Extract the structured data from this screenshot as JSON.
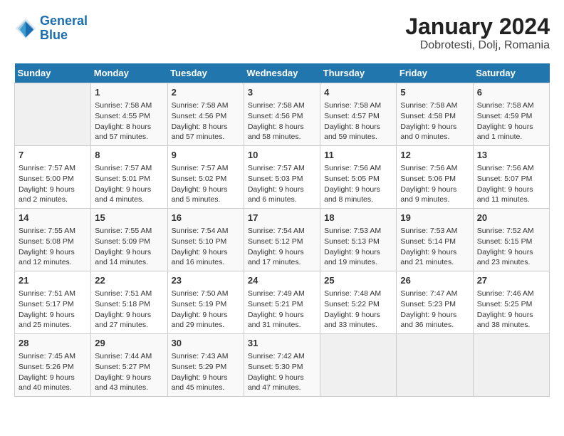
{
  "logo": {
    "line1": "General",
    "line2": "Blue"
  },
  "title": "January 2024",
  "subtitle": "Dobrotesti, Dolj, Romania",
  "weekdays": [
    "Sunday",
    "Monday",
    "Tuesday",
    "Wednesday",
    "Thursday",
    "Friday",
    "Saturday"
  ],
  "weeks": [
    [
      {
        "day": "",
        "info": ""
      },
      {
        "day": "1",
        "info": "Sunrise: 7:58 AM\nSunset: 4:55 PM\nDaylight: 8 hours\nand 57 minutes."
      },
      {
        "day": "2",
        "info": "Sunrise: 7:58 AM\nSunset: 4:56 PM\nDaylight: 8 hours\nand 57 minutes."
      },
      {
        "day": "3",
        "info": "Sunrise: 7:58 AM\nSunset: 4:56 PM\nDaylight: 8 hours\nand 58 minutes."
      },
      {
        "day": "4",
        "info": "Sunrise: 7:58 AM\nSunset: 4:57 PM\nDaylight: 8 hours\nand 59 minutes."
      },
      {
        "day": "5",
        "info": "Sunrise: 7:58 AM\nSunset: 4:58 PM\nDaylight: 9 hours\nand 0 minutes."
      },
      {
        "day": "6",
        "info": "Sunrise: 7:58 AM\nSunset: 4:59 PM\nDaylight: 9 hours\nand 1 minute."
      }
    ],
    [
      {
        "day": "7",
        "info": "Sunrise: 7:57 AM\nSunset: 5:00 PM\nDaylight: 9 hours\nand 2 minutes."
      },
      {
        "day": "8",
        "info": "Sunrise: 7:57 AM\nSunset: 5:01 PM\nDaylight: 9 hours\nand 4 minutes."
      },
      {
        "day": "9",
        "info": "Sunrise: 7:57 AM\nSunset: 5:02 PM\nDaylight: 9 hours\nand 5 minutes."
      },
      {
        "day": "10",
        "info": "Sunrise: 7:57 AM\nSunset: 5:03 PM\nDaylight: 9 hours\nand 6 minutes."
      },
      {
        "day": "11",
        "info": "Sunrise: 7:56 AM\nSunset: 5:05 PM\nDaylight: 9 hours\nand 8 minutes."
      },
      {
        "day": "12",
        "info": "Sunrise: 7:56 AM\nSunset: 5:06 PM\nDaylight: 9 hours\nand 9 minutes."
      },
      {
        "day": "13",
        "info": "Sunrise: 7:56 AM\nSunset: 5:07 PM\nDaylight: 9 hours\nand 11 minutes."
      }
    ],
    [
      {
        "day": "14",
        "info": "Sunrise: 7:55 AM\nSunset: 5:08 PM\nDaylight: 9 hours\nand 12 minutes."
      },
      {
        "day": "15",
        "info": "Sunrise: 7:55 AM\nSunset: 5:09 PM\nDaylight: 9 hours\nand 14 minutes."
      },
      {
        "day": "16",
        "info": "Sunrise: 7:54 AM\nSunset: 5:10 PM\nDaylight: 9 hours\nand 16 minutes."
      },
      {
        "day": "17",
        "info": "Sunrise: 7:54 AM\nSunset: 5:12 PM\nDaylight: 9 hours\nand 17 minutes."
      },
      {
        "day": "18",
        "info": "Sunrise: 7:53 AM\nSunset: 5:13 PM\nDaylight: 9 hours\nand 19 minutes."
      },
      {
        "day": "19",
        "info": "Sunrise: 7:53 AM\nSunset: 5:14 PM\nDaylight: 9 hours\nand 21 minutes."
      },
      {
        "day": "20",
        "info": "Sunrise: 7:52 AM\nSunset: 5:15 PM\nDaylight: 9 hours\nand 23 minutes."
      }
    ],
    [
      {
        "day": "21",
        "info": "Sunrise: 7:51 AM\nSunset: 5:17 PM\nDaylight: 9 hours\nand 25 minutes."
      },
      {
        "day": "22",
        "info": "Sunrise: 7:51 AM\nSunset: 5:18 PM\nDaylight: 9 hours\nand 27 minutes."
      },
      {
        "day": "23",
        "info": "Sunrise: 7:50 AM\nSunset: 5:19 PM\nDaylight: 9 hours\nand 29 minutes."
      },
      {
        "day": "24",
        "info": "Sunrise: 7:49 AM\nSunset: 5:21 PM\nDaylight: 9 hours\nand 31 minutes."
      },
      {
        "day": "25",
        "info": "Sunrise: 7:48 AM\nSunset: 5:22 PM\nDaylight: 9 hours\nand 33 minutes."
      },
      {
        "day": "26",
        "info": "Sunrise: 7:47 AM\nSunset: 5:23 PM\nDaylight: 9 hours\nand 36 minutes."
      },
      {
        "day": "27",
        "info": "Sunrise: 7:46 AM\nSunset: 5:25 PM\nDaylight: 9 hours\nand 38 minutes."
      }
    ],
    [
      {
        "day": "28",
        "info": "Sunrise: 7:45 AM\nSunset: 5:26 PM\nDaylight: 9 hours\nand 40 minutes."
      },
      {
        "day": "29",
        "info": "Sunrise: 7:44 AM\nSunset: 5:27 PM\nDaylight: 9 hours\nand 43 minutes."
      },
      {
        "day": "30",
        "info": "Sunrise: 7:43 AM\nSunset: 5:29 PM\nDaylight: 9 hours\nand 45 minutes."
      },
      {
        "day": "31",
        "info": "Sunrise: 7:42 AM\nSunset: 5:30 PM\nDaylight: 9 hours\nand 47 minutes."
      },
      {
        "day": "",
        "info": ""
      },
      {
        "day": "",
        "info": ""
      },
      {
        "day": "",
        "info": ""
      }
    ]
  ]
}
